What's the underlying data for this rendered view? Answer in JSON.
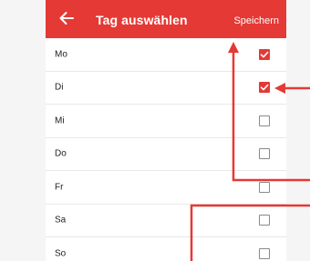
{
  "appbar": {
    "title": "Tag auswählen",
    "save_label": "Speichern",
    "back_icon": "arrow-left-icon"
  },
  "days": [
    {
      "label": "Mo",
      "checked": true
    },
    {
      "label": "Di",
      "checked": true
    },
    {
      "label": "Mi",
      "checked": false
    },
    {
      "label": "Do",
      "checked": false
    },
    {
      "label": "Fr",
      "checked": false
    },
    {
      "label": "Sa",
      "checked": false
    },
    {
      "label": "So",
      "checked": false
    }
  ],
  "colors": {
    "accent": "#e53935",
    "annotation": "#e53935",
    "checkbox_border": "#8a8a8a"
  }
}
